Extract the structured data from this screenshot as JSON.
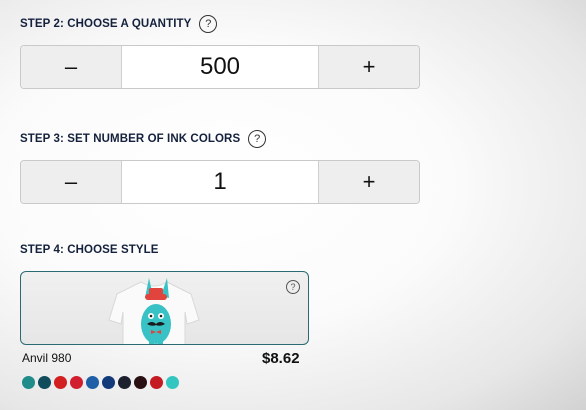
{
  "step2": {
    "title": "STEP 2: CHOOSE A QUANTITY",
    "help": "?",
    "minus": "–",
    "value": "500",
    "plus": "+"
  },
  "step3": {
    "title": "STEP 3: SET NUMBER OF INK COLORS",
    "help": "?",
    "minus": "–",
    "value": "1",
    "plus": "+"
  },
  "step4": {
    "title": "STEP 4: CHOOSE STYLE",
    "card_help": "?",
    "product_name": "Anvil 980",
    "price": "$8.62",
    "swatches": [
      "#1f8c8a",
      "#0f4c5c",
      "#d21f1f",
      "#d11f2f",
      "#1f5fa8",
      "#123a7a",
      "#1b1f2e",
      "#2a0f12",
      "#c41a22",
      "#33c6c0"
    ]
  },
  "colors": {
    "title": "#14213d",
    "accent_border": "#2a6b73"
  }
}
